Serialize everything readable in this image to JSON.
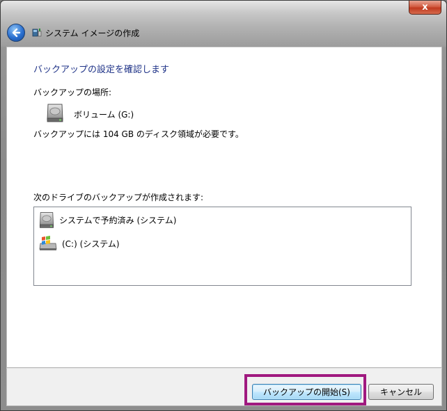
{
  "window": {
    "title": "システム イメージの作成",
    "close_glyph": "x"
  },
  "content": {
    "heading": "バックアップの設定を確認します",
    "location_label": "バックアップの場所:",
    "location_value": "ボリューム (G:)",
    "size_note": "バックアップには 104 GB のディスク領域が必要です。",
    "drives_label": "次のドライブのバックアップが作成されます:",
    "drives": [
      {
        "label": "システムで予約済み (システム)",
        "icon": "hard-drive-icon"
      },
      {
        "label": "(C:) (システム)",
        "icon": "windows-drive-icon"
      }
    ]
  },
  "buttons": {
    "start_backup": "バックアップの開始(S)",
    "cancel": "キャンセル"
  },
  "colors": {
    "heading": "#1e3287",
    "highlight": "#a0197f"
  }
}
